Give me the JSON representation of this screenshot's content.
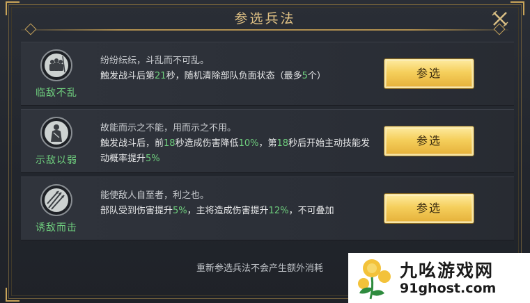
{
  "dialog": {
    "title": "参选兵法",
    "close_icon": "close-x-icon",
    "accent_color": "#e0c184",
    "highlight_color": "#6fcf7e"
  },
  "tactics": [
    {
      "icon": "soldiers-group-icon",
      "name": "临敌不乱",
      "quote": "纷纷纭纭，斗乱而不可乱。",
      "effect_parts": [
        "触发战斗后第",
        "21",
        "秒，随机清除部队负面状态（最多",
        "5",
        "个）"
      ],
      "button": "参选"
    },
    {
      "icon": "cloaked-figure-icon",
      "name": "示敌以弱",
      "quote": "故能而示之不能，用而示之不用。",
      "effect_parts": [
        "触发战斗后，前",
        "18",
        "秒造成伤害降低",
        "10%",
        "，第",
        "18",
        "秒后开始主动技能发动概率提升",
        "5%"
      ],
      "button": "参选"
    },
    {
      "icon": "arrows-volley-icon",
      "name": "诱敌而击",
      "quote": "能使敌人自至者，利之也。",
      "effect_parts": [
        "部队受到伤害提升",
        "5%",
        "，主将造成伤害提升",
        "12%",
        "，不可叠加"
      ],
      "button": "参选"
    }
  ],
  "footer_note": "重新参选兵法不会产生额外消耗",
  "watermark": {
    "title": "九吆游戏网",
    "url": "91ghost.com",
    "logo_icon": "dandelion-logo-icon"
  }
}
